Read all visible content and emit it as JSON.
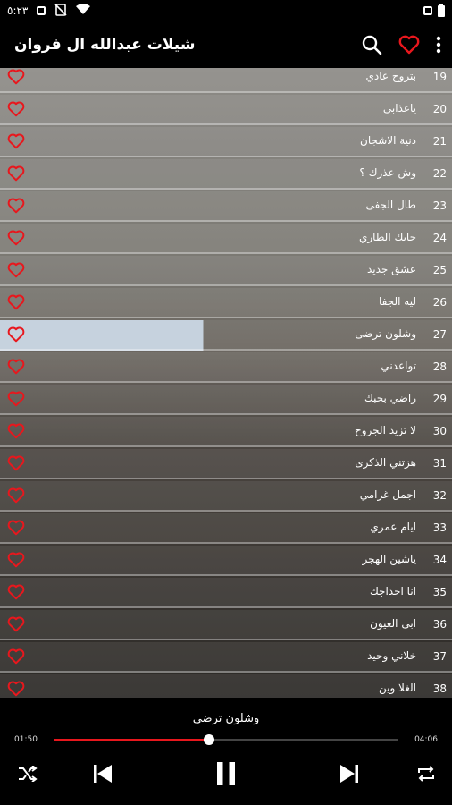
{
  "status_bar": {
    "time": "٥:٢٣"
  },
  "app_bar": {
    "title": "شيلات عبدالله ال فروان",
    "icons": [
      "search-icon",
      "heart-icon",
      "more-vert-icon"
    ]
  },
  "tracks": [
    {
      "num": "19",
      "name": "بتروح عادي"
    },
    {
      "num": "20",
      "name": "ياعذابي"
    },
    {
      "num": "21",
      "name": "دنية الاشجان"
    },
    {
      "num": "22",
      "name": "وش عذرك ؟"
    },
    {
      "num": "23",
      "name": "طال الجفى"
    },
    {
      "num": "24",
      "name": "جابك الطاري"
    },
    {
      "num": "25",
      "name": "عشق جديد"
    },
    {
      "num": "26",
      "name": "ليه الجفا"
    },
    {
      "num": "27",
      "name": "وشلون ترضى"
    },
    {
      "num": "28",
      "name": "تواعدني"
    },
    {
      "num": "29",
      "name": "راضي بحبك"
    },
    {
      "num": "30",
      "name": "لا تزيد الجروح"
    },
    {
      "num": "31",
      "name": "هزتني الذكرى"
    },
    {
      "num": "32",
      "name": "اجمل غرامي"
    },
    {
      "num": "33",
      "name": "ايام عمري"
    },
    {
      "num": "34",
      "name": "ياشين الهجر"
    },
    {
      "num": "35",
      "name": "انا احداجك"
    },
    {
      "num": "36",
      "name": "ابى العيون"
    },
    {
      "num": "37",
      "name": "خلاني وحيد"
    },
    {
      "num": "38",
      "name": "الغلا وين"
    }
  ],
  "active_track_index": 8,
  "player": {
    "now_playing": "وشلون ترضى",
    "current_time": "01:50",
    "total_time": "04:06",
    "progress": 0.45
  },
  "colors": {
    "accent": "#e8171d",
    "active_row": "#c6d2de"
  }
}
